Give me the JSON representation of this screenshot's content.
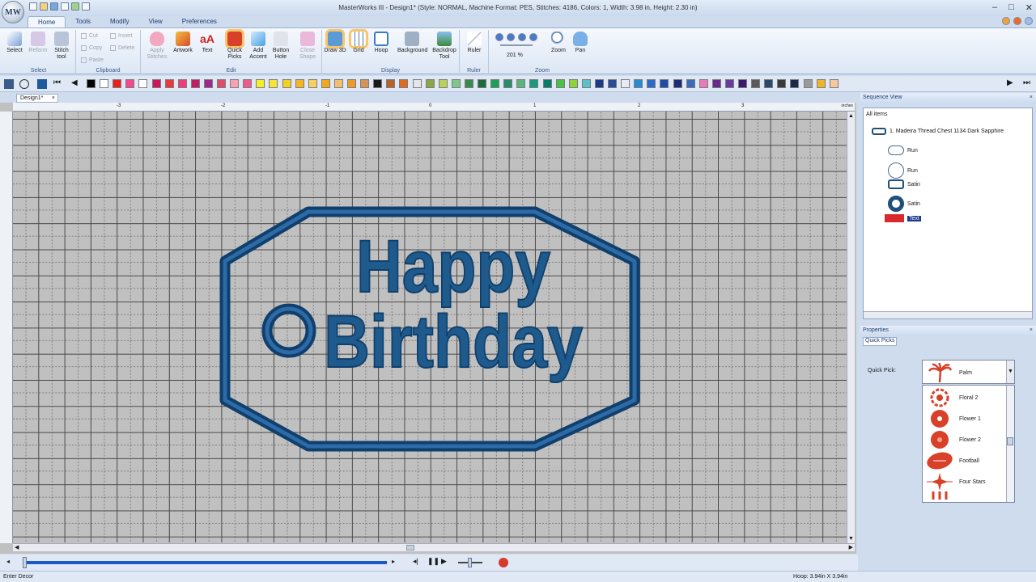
{
  "window": {
    "title": "MasterWorks III - Design1* (Style: NORMAL, Machine Format: PES, Stitches: 4186, Colors: 1, Width: 3.98 in, Height: 2.30 in)",
    "logo_text": "MW"
  },
  "menu": {
    "tabs": [
      "Home",
      "Tools",
      "Modify",
      "View",
      "Preferences"
    ]
  },
  "ribbon": {
    "select": {
      "label": "Select",
      "buttons": [
        "Select",
        "Reform",
        "Stitch tool"
      ]
    },
    "clipboard": {
      "label": "Clipboard",
      "items": [
        "Cut",
        "Insert",
        "Copy",
        "Delete",
        "Paste"
      ]
    },
    "edit": {
      "label": "Edit",
      "buttons": [
        "Apply Stitches",
        "Artwork",
        "Text",
        "Quick Picks",
        "Add Accent",
        "Button Hole",
        "Close Shape"
      ]
    },
    "display": {
      "label": "Display",
      "buttons": [
        "Draw 3D",
        "Grid",
        "Hoop",
        "Background",
        "Backdrop Tool"
      ]
    },
    "ruler": {
      "label": "Ruler",
      "buttons": [
        "Ruler"
      ]
    },
    "zoom": {
      "label": "Zoom",
      "value": "201 %",
      "buttons": [
        "Zoom",
        "Pan"
      ]
    }
  },
  "palette": [
    "#000000",
    "#ffffff",
    "#e8201e",
    "#f24a8c",
    "#ffffff",
    "#c8185a",
    "#e83a3a",
    "#f03c78",
    "#c01e64",
    "#9c2a8c",
    "#e04a6e",
    "#f7a0b0",
    "#f05a8c",
    "#f2f02a",
    "#f6e43c",
    "#f2d21e",
    "#f5b422",
    "#f6d060",
    "#f0a81e",
    "#f0c070",
    "#ee9a2a",
    "#d49458",
    "#1a1a1a",
    "#b86428",
    "#e06a1e",
    "#e2e6ea",
    "#8ca646",
    "#b8d25a",
    "#7ec88a",
    "#3a8a4e",
    "#1e6a3a",
    "#1aa05a",
    "#2a8a6a",
    "#5ab47c",
    "#1a9a78",
    "#0a7a68",
    "#4ac24a",
    "#8ed23c",
    "#5ac2c8",
    "#1a3a8a",
    "#2a4a9a",
    "#e8ecf2",
    "#2a8ad2",
    "#2a6ac8",
    "#1e4aa8",
    "#1e2a7a",
    "#3a6ab8",
    "#e87ab8",
    "#6a2a8a",
    "#6a3aa2",
    "#3a1a6a",
    "#5a5a5a",
    "#2a4a6a",
    "#3a3a3a",
    "#1a2a4a",
    "#9a9a9a",
    "#f0b428",
    "#f6c8a0"
  ],
  "document": {
    "tab": "Design1*"
  },
  "ruler": {
    "h_ticks": [
      "-3",
      "-2",
      "-1",
      "0",
      "1",
      "2",
      "3"
    ],
    "unit": "inches",
    "v_unit": "inches"
  },
  "design": {
    "line1": "Happy",
    "line2": "Birthday",
    "color": "#1f5a8c"
  },
  "sequence_view": {
    "title": "Sequence View",
    "root": "All items",
    "thread": "1. Madeira Thread Chest 1134 Dark Sapphire",
    "items": [
      {
        "label": "Run",
        "icon": "oval-outline-icon"
      },
      {
        "label": "Run",
        "icon": "circle-outline-icon"
      },
      {
        "label": "Satin",
        "icon": "rounded-rect-icon"
      },
      {
        "label": "Satin",
        "icon": "ring-icon"
      },
      {
        "label": "Text",
        "icon": "text-icon"
      }
    ]
  },
  "properties": {
    "title": "Properties",
    "tab": "Quick Picks",
    "quick_pick_label": "Quick Pick:",
    "selected": "Palm",
    "options": [
      "Floral 2",
      "Flower 1",
      "Flower 2",
      "Football",
      "Four Stars"
    ]
  },
  "status": {
    "left": "Enter Decor",
    "right": "Hoop: 3.94in X 3.94in"
  }
}
